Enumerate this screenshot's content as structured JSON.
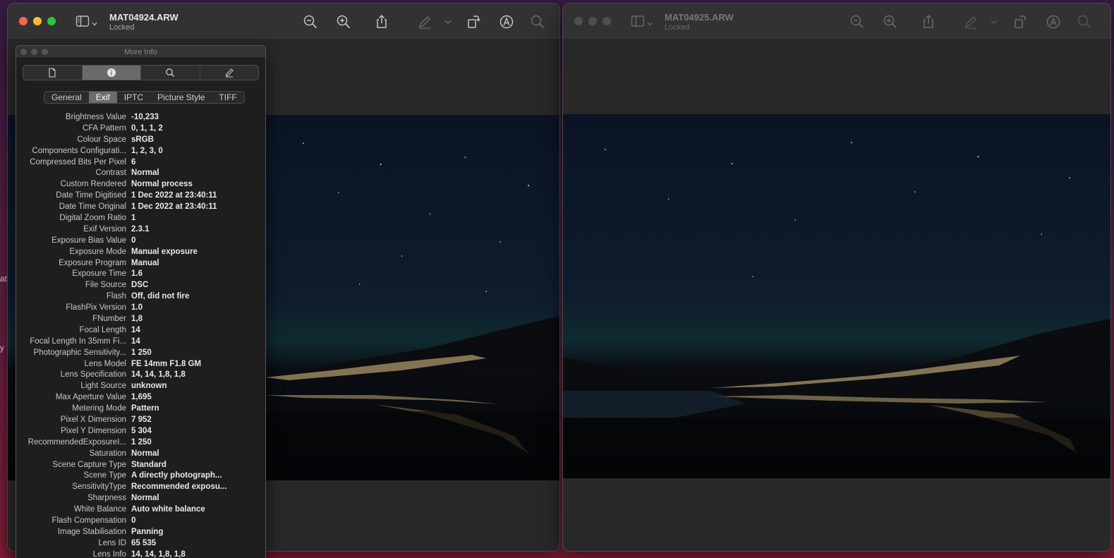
{
  "desktop": {
    "fragments": [
      "at",
      "y"
    ]
  },
  "left_window": {
    "title": "MAT04924.ARW",
    "subtitle": "Locked",
    "icons": [
      "sidebar-icon",
      "zoom-out-icon",
      "zoom-in-icon",
      "share-icon",
      "markup-pen-icon",
      "rotate-icon",
      "annotate-icon",
      "search-icon"
    ]
  },
  "right_window": {
    "title": "MAT04925.ARW",
    "subtitle": "Locked"
  },
  "info_panel": {
    "title": "More Info",
    "modes": [
      "document-icon",
      "info-icon",
      "search-icon",
      "pencil-icon"
    ],
    "active_mode": 1,
    "tabs": [
      "General",
      "Exif",
      "IPTC",
      "Picture Style",
      "TIFF"
    ],
    "active_tab": 1,
    "properties": [
      {
        "key": "Brightness Value",
        "value": "-10,233"
      },
      {
        "key": "CFA Pattern",
        "value": "0, 1, 1, 2"
      },
      {
        "key": "Colour Space",
        "value": "sRGB"
      },
      {
        "key": "Components Configurati...",
        "value": "1, 2, 3, 0"
      },
      {
        "key": "Compressed Bits Per Pixel",
        "value": "6"
      },
      {
        "key": "Contrast",
        "value": "Normal"
      },
      {
        "key": "Custom Rendered",
        "value": "Normal process"
      },
      {
        "key": "Date Time Digitised",
        "value": "1 Dec 2022 at 23:40:11"
      },
      {
        "key": "Date Time Original",
        "value": "1 Dec 2022 at 23:40:11"
      },
      {
        "key": "Digital Zoom Ratio",
        "value": "1"
      },
      {
        "key": "Exif Version",
        "value": "2.3.1"
      },
      {
        "key": "Exposure Bias Value",
        "value": "0"
      },
      {
        "key": "Exposure Mode",
        "value": "Manual exposure"
      },
      {
        "key": "Exposure Program",
        "value": "Manual"
      },
      {
        "key": "Exposure Time",
        "value": "1.6"
      },
      {
        "key": "File Source",
        "value": "DSC"
      },
      {
        "key": "Flash",
        "value": "Off, did not fire"
      },
      {
        "key": "FlashPix Version",
        "value": "1.0"
      },
      {
        "key": "FNumber",
        "value": "1,8"
      },
      {
        "key": "Focal Length",
        "value": "14"
      },
      {
        "key": "Focal Length In 35mm Fi...",
        "value": "14"
      },
      {
        "key": "Photographic Sensitivity...",
        "value": "1 250"
      },
      {
        "key": "Lens Model",
        "value": "FE 14mm F1.8 GM"
      },
      {
        "key": "Lens Specification",
        "value": "14, 14, 1,8, 1,8"
      },
      {
        "key": "Light Source",
        "value": "unknown"
      },
      {
        "key": "Max Aperture Value",
        "value": "1,695"
      },
      {
        "key": "Metering Mode",
        "value": "Pattern"
      },
      {
        "key": "Pixel X Dimension",
        "value": "7 952"
      },
      {
        "key": "Pixel Y Dimension",
        "value": "5 304"
      },
      {
        "key": "RecommendedExposureI...",
        "value": "1 250"
      },
      {
        "key": "Saturation",
        "value": "Normal"
      },
      {
        "key": "Scene Capture Type",
        "value": "Standard"
      },
      {
        "key": "Scene Type",
        "value": "A directly photograph..."
      },
      {
        "key": "SensitivityType",
        "value": "Recommended exposu..."
      },
      {
        "key": "Sharpness",
        "value": "Normal"
      },
      {
        "key": "White Balance",
        "value": "Auto white balance"
      },
      {
        "key": "Flash Compensation",
        "value": "0"
      },
      {
        "key": "Image Stabilisation",
        "value": "Panning"
      },
      {
        "key": "Lens ID",
        "value": "65 535"
      },
      {
        "key": "Lens Info",
        "value": "14, 14, 1,8, 1,8"
      }
    ]
  }
}
